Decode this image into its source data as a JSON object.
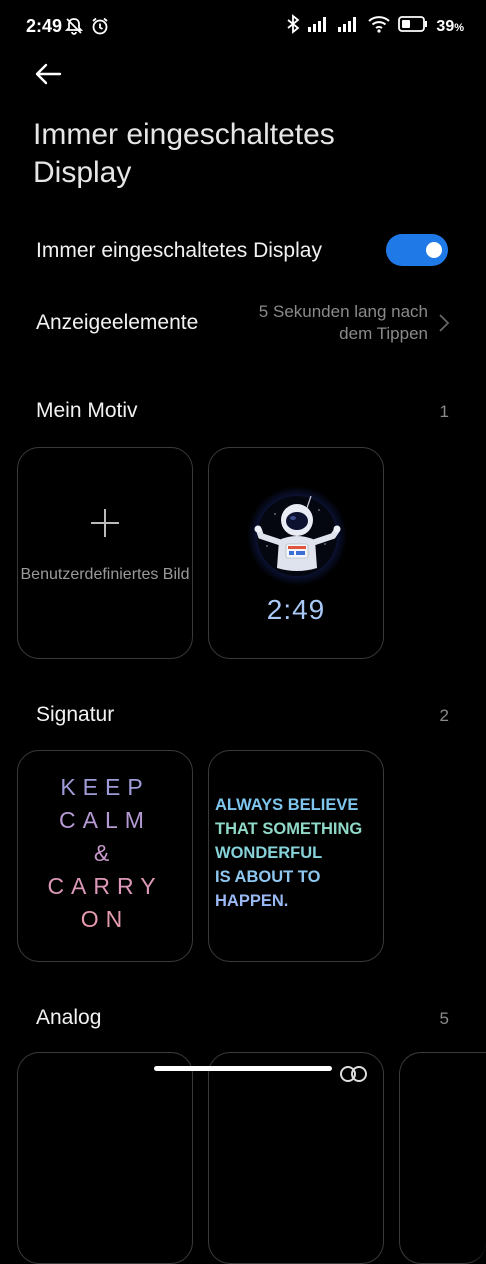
{
  "status_bar": {
    "time": "2:49",
    "battery": "39",
    "battery_unit": "%",
    "icons": [
      "notifications-off-icon",
      "alarm-icon",
      "bluetooth-icon",
      "signal-icon",
      "signal-icon",
      "wifi-icon",
      "battery-icon"
    ]
  },
  "header": {
    "title": "Immer eingeschaltetes Display"
  },
  "settings": {
    "aod_label": "Immer eingeschaltetes Display",
    "aod_enabled": true,
    "elements_label": "Anzeigeelemente",
    "elements_value": "5 Sekunden lang nach dem Tippen"
  },
  "sections": {
    "motiv": {
      "title": "Mein Motiv",
      "count": "1"
    },
    "signatur": {
      "title": "Signatur",
      "count": "2"
    },
    "analog": {
      "title": "Analog",
      "count": "5"
    }
  },
  "cards": {
    "custom_caption": "Benutzerdefiniertes Bild",
    "astro_time": "2:49",
    "keep_calm": [
      "KEEP",
      "CALM",
      "&",
      "CARRY",
      "ON"
    ],
    "always_believe": [
      "ALWAYS BELIEVE",
      "THAT SOMETHING",
      "WONDERFUL",
      "IS ABOUT TO",
      "HAPPEN."
    ]
  },
  "colors": {
    "accent": "#1f7ae8",
    "background": "#000000",
    "secondary_text": "#8a8a8a"
  }
}
